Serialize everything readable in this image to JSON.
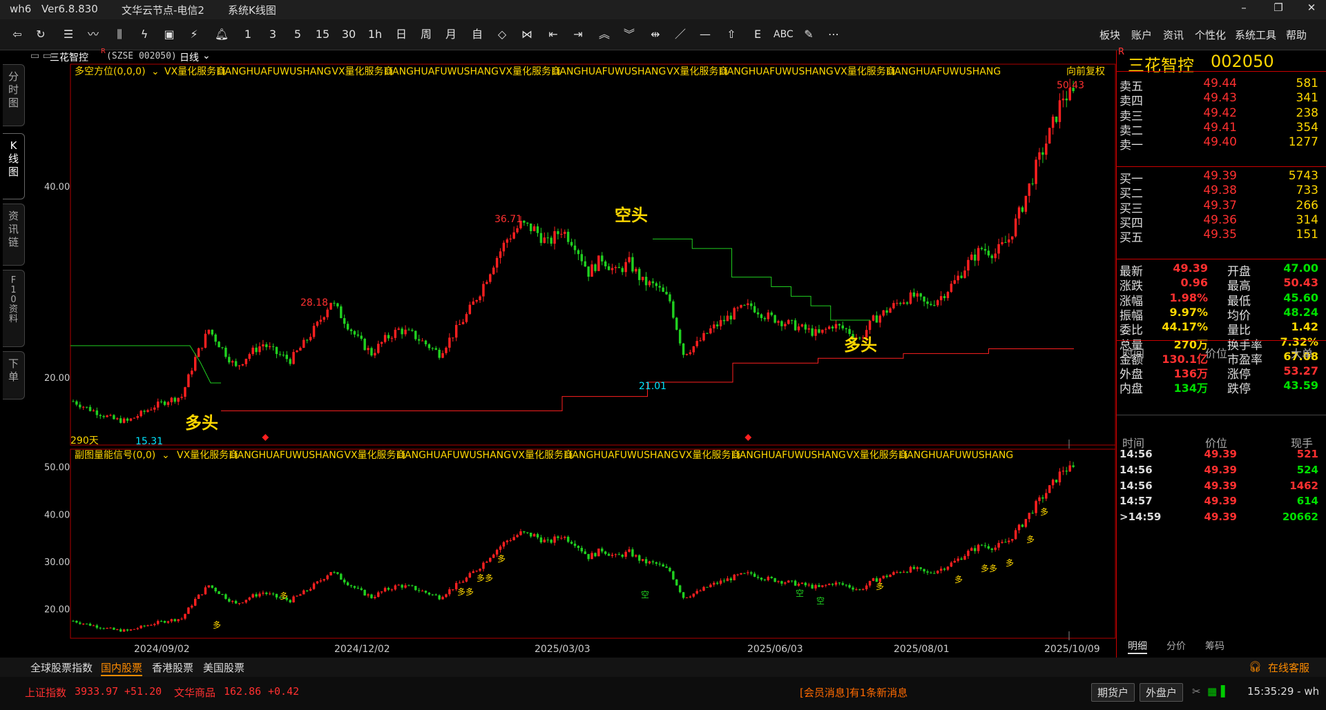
{
  "titlebar": {
    "app": "wh6",
    "version": "Ver6.8.830",
    "server": "文华云节点-电信2",
    "view": "系统K线图"
  },
  "window_buttons": [
    "–",
    "❐",
    "✕"
  ],
  "toolbar": {
    "periods": [
      "1",
      "3",
      "5",
      "15",
      "30",
      "1h",
      "日",
      "周",
      "月",
      "自"
    ],
    "abc_label": "ABC",
    "menus": [
      "板块",
      "账户",
      "资讯",
      "个性化",
      "系统工具",
      "帮助"
    ]
  },
  "left_tabs": [
    "分\n时\n图",
    "K\n线\n图",
    "资\n讯\n链",
    "F\n1\n0\n资\n料",
    "下\n单"
  ],
  "header": {
    "name": "三花智控",
    "code_tag": "(SZSE 002050)",
    "period": "日线"
  },
  "main_chart": {
    "indicator": "多空方位(0,0,0)",
    "ad_segments": [
      "VX量化服务商",
      "LIANGHUAFUWUSHANG",
      "VX量化服务商",
      "LIANGHUAFUWUSHANG",
      "VX量化服务商",
      "LIANGHUAFUWUSHANG",
      "VX量化服务商",
      "LIANGHUAFUWUSHANG",
      "VX量化服务商",
      "LIANGHUAFUWUSHANG"
    ],
    "fuquan": "向前复权",
    "days": "290天",
    "y_ticks": [
      "40.00",
      "20.00"
    ],
    "annotations": {
      "max": "50.43",
      "p3671": "36.71",
      "p2818": "28.18",
      "p2101": "21.01",
      "min": "15.31",
      "duo1": "多头",
      "duo2": "多头",
      "kong": "空头"
    }
  },
  "sub_chart": {
    "indicator": "副图量能信号(0,0)",
    "ad_segments": [
      "VX量化服务商",
      "LIANGHUAFUWUSHANG",
      "VX量化服务商",
      "LIANGHUAFUWUSHANG",
      "VX量化服务商",
      "LIANGHUAFUWUSHANG",
      "VX量化服务商",
      "LIANGHUAFUWUSHANG",
      "VX量化服务商",
      "LIANGHUAFUWUSHANG"
    ],
    "y_ticks": [
      "50.00",
      "40.00",
      "30.00",
      "20.00"
    ]
  },
  "x_dates": [
    "2024/09/02",
    "2024/12/02",
    "2025/03/03",
    "2025/06/03",
    "2025/08/01",
    "2025/10/09"
  ],
  "chart_data": {
    "type": "candlestick",
    "title": "三花智控 (SZSE 002050) 日线",
    "x_ticks": [
      "2024/09/02",
      "2024/12/02",
      "2025/03/03",
      "2025/06/03",
      "2025/08/01",
      "2025/10/09"
    ],
    "ylim": [
      14,
      52
    ],
    "y_ticks": [
      20,
      40
    ],
    "labeled_points": [
      {
        "label": "15.31",
        "x": "2024/09",
        "y": 15.31
      },
      {
        "label": "28.18",
        "x": "2024/11",
        "y": 28.18
      },
      {
        "label": "36.71",
        "x": "2025/02",
        "y": 36.71
      },
      {
        "label": "21.01",
        "x": "2025/04",
        "y": 21.01
      },
      {
        "label": "50.43",
        "x": "2025/10",
        "y": 50.43
      }
    ],
    "close_path": [
      17.5,
      16.8,
      16.2,
      15.6,
      15.4,
      16.2,
      17.0,
      17.6,
      18.0,
      22.0,
      25.0,
      23.0,
      21.0,
      22.5,
      23.5,
      22.5,
      21.8,
      23.5,
      25.5,
      28.0,
      26.0,
      24.0,
      22.5,
      24.0,
      25.0,
      24.5,
      23.5,
      22.5,
      24.5,
      26.5,
      29.0,
      32.0,
      34.5,
      36.0,
      35.5,
      34.0,
      35.5,
      34.0,
      31.0,
      32.5,
      31.0,
      32.0,
      30.0,
      29.5,
      28.0,
      22.5,
      23.5,
      25.0,
      26.0,
      27.0,
      27.5,
      26.5,
      26.0,
      25.5,
      25.0,
      24.5,
      25.5,
      25.0,
      24.0,
      26.0,
      27.0,
      28.0,
      28.5,
      27.5,
      28.5,
      30.0,
      32.0,
      33.5,
      33.0,
      34.5,
      38.0,
      42.0,
      45.5,
      49.5
    ],
    "signal_lines": [
      {
        "name": "多头",
        "color": "#ff2020",
        "values": [
          16.5,
          16.5,
          16.5,
          16.5,
          16.5,
          16.5,
          16.5,
          16.5,
          18.0,
          18.0,
          19.5,
          19.5,
          21.5,
          21.5,
          22.0,
          22.0,
          22.5,
          22.5,
          23.0,
          23.0
        ]
      },
      {
        "name": "空头",
        "color": "#20d020",
        "values": [
          34.5,
          34.5,
          33.5,
          33.5,
          30.5,
          30.5,
          29.5,
          28.5,
          27.5,
          26.0,
          26.0
        ]
      }
    ]
  },
  "quote": {
    "name": "三花智控",
    "code": "002050",
    "asks": [
      {
        "label": "卖五",
        "price": "49.44",
        "vol": "581"
      },
      {
        "label": "卖四",
        "price": "49.43",
        "vol": "341"
      },
      {
        "label": "卖三",
        "price": "49.42",
        "vol": "238"
      },
      {
        "label": "卖二",
        "price": "49.41",
        "vol": "354"
      },
      {
        "label": "卖一",
        "price": "49.40",
        "vol": "1277"
      }
    ],
    "bids": [
      {
        "label": "买一",
        "price": "49.39",
        "vol": "5743"
      },
      {
        "label": "买二",
        "price": "49.38",
        "vol": "733"
      },
      {
        "label": "买三",
        "price": "49.37",
        "vol": "266"
      },
      {
        "label": "买四",
        "price": "49.36",
        "vol": "314"
      },
      {
        "label": "买五",
        "price": "49.35",
        "vol": "151"
      }
    ],
    "stats": [
      {
        "l1": "最新",
        "v1": "49.39",
        "c1": "red",
        "l2": "开盘",
        "v2": "47.00",
        "c2": "green"
      },
      {
        "l1": "涨跌",
        "v1": "0.96",
        "c1": "red",
        "l2": "最高",
        "v2": "50.43",
        "c2": "red"
      },
      {
        "l1": "涨幅",
        "v1": "1.98%",
        "c1": "red",
        "l2": "最低",
        "v2": "45.60",
        "c2": "green"
      },
      {
        "l1": "振幅",
        "v1": "9.97%",
        "c1": "yellow",
        "l2": "均价",
        "v2": "48.24",
        "c2": "green"
      },
      {
        "l1": "委比",
        "v1": "44.17%",
        "c1": "yellow",
        "l2": "量比",
        "v2": "1.42",
        "c2": "yellow"
      },
      {
        "l1": "总量",
        "v1": "270万",
        "c1": "yellow",
        "l2": "换手率",
        "v2": "7.32%",
        "c2": "yellow"
      },
      {
        "l1": "金额",
        "v1": "130.1亿",
        "c1": "red",
        "l2": "市盈率",
        "v2": "67.08",
        "c2": "yellow"
      },
      {
        "l1": "外盘",
        "v1": "136万",
        "c1": "red",
        "l2": "涨停",
        "v2": "53.27",
        "c2": "red"
      },
      {
        "l1": "内盘",
        "v1": "134万",
        "c1": "green",
        "l2": "跌停",
        "v2": "43.59",
        "c2": "green"
      }
    ],
    "big_header": {
      "time": "时间",
      "price": "价位",
      "vol": "大单"
    },
    "tick_header": {
      "time": "时间",
      "price": "价位",
      "vol": "现手"
    },
    "ticks": [
      {
        "time": "14:56",
        "price": "49.39",
        "vol": "521",
        "vc": "red"
      },
      {
        "time": "14:56",
        "price": "49.39",
        "vol": "524",
        "vc": "green"
      },
      {
        "time": "14:56",
        "price": "49.39",
        "vol": "1462",
        "vc": "red"
      },
      {
        "time": "14:57",
        "price": "49.39",
        "vol": "614",
        "vc": "green"
      },
      {
        "time": ">14:59",
        "price": "49.39",
        "vol": "20662",
        "vc": "green"
      }
    ],
    "tabs": [
      "明细",
      "分价",
      "筹码"
    ]
  },
  "bottom_tabs": [
    "全球股票指数",
    "国内股票",
    "香港股票",
    "美国股票"
  ],
  "service": "在线客服",
  "status": {
    "idx1_name": "上证指数",
    "idx1_val": "3933.97",
    "idx1_chg": "+51.20",
    "idx2_name": "文华商品",
    "idx2_val": "162.86",
    "idx2_chg": "+0.42",
    "message": "[会员消息]有1条新消息",
    "btn1": "期货户",
    "btn2": "外盘户",
    "clock": "15:35:29 - wh"
  }
}
